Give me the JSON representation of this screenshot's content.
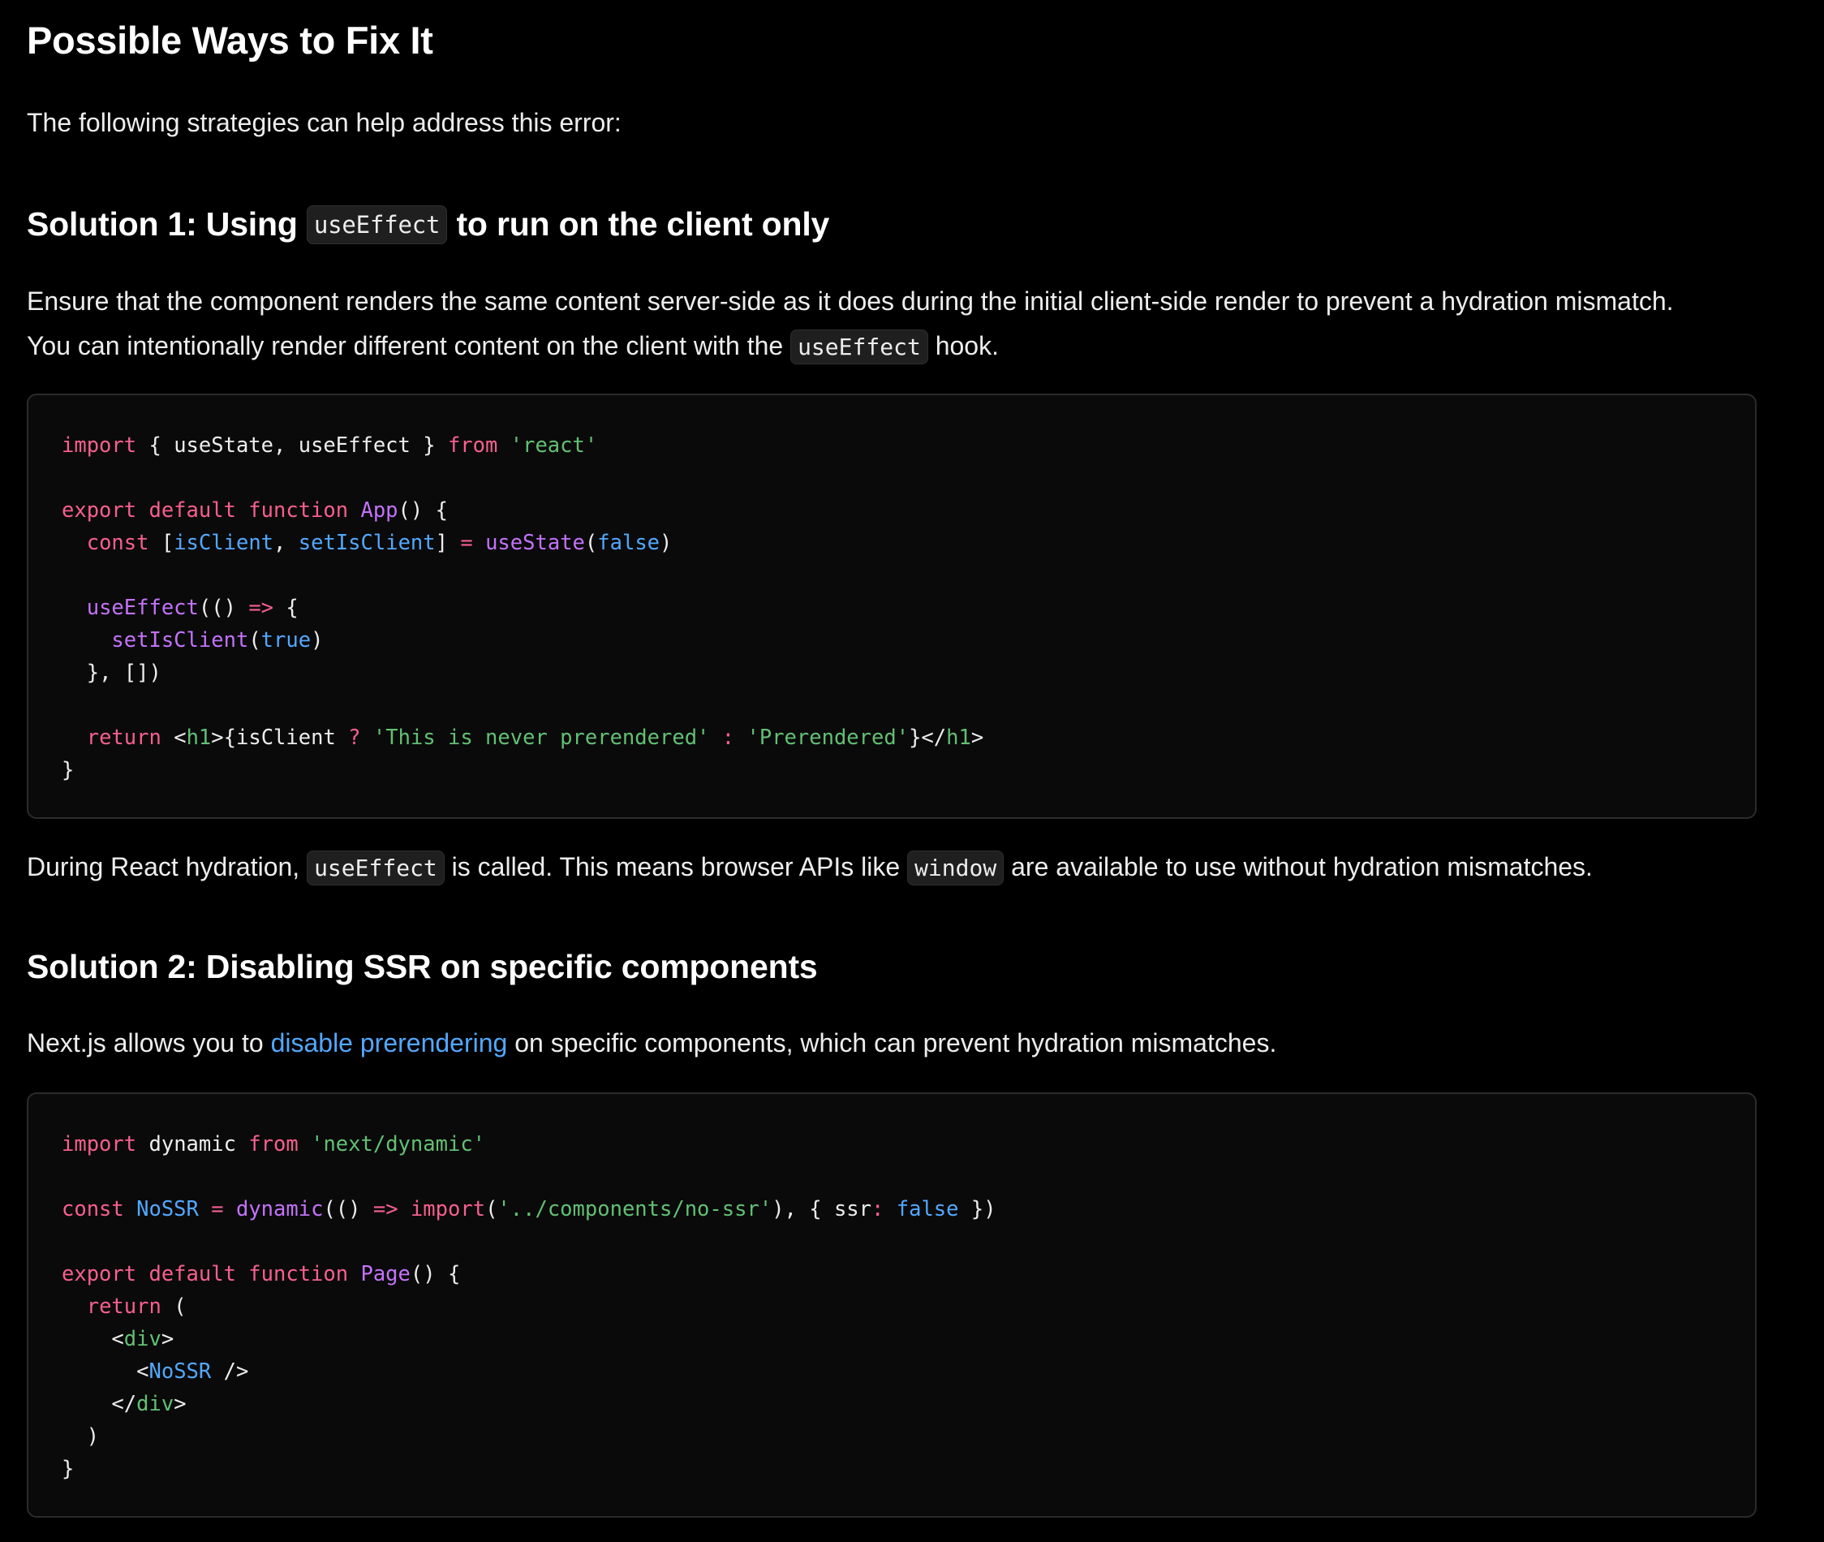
{
  "page": {
    "title": "Possible Ways to Fix It",
    "intro": "The following strategies can help address this error:"
  },
  "solution1": {
    "heading_prefix": "Solution 1: Using",
    "heading_code": "useEffect",
    "heading_suffix": "to run on the client only",
    "para_line1": "Ensure that the component renders the same content server-side as it does during the initial client-side render to prevent a hydration mismatch.",
    "para_line2_prefix": "You can intentionally render different content on the client with the",
    "para_line2_code": "useEffect",
    "para_line2_suffix": "hook.",
    "after_prefix": "During React hydration,",
    "after_code1": "useEffect",
    "after_mid": "is called. This means browser APIs like",
    "after_code2": "window",
    "after_suffix": "are available to use without hydration mismatches."
  },
  "code1": {
    "l1": [
      "import",
      "{ useState, useEffect }",
      "from",
      "'react'"
    ],
    "l3": [
      "export default function",
      "App",
      "() {"
    ],
    "l4": [
      "const",
      "[",
      "isClient",
      ",",
      "setIsClient",
      "] ",
      "=",
      "useState",
      "(",
      "false",
      ")"
    ],
    "l6": [
      "useEffect",
      "(() ",
      "=>",
      " {"
    ],
    "l7": [
      "setIsClient",
      "(",
      "true",
      ")"
    ],
    "l8": "}, [])",
    "l10": [
      "return",
      "<",
      "h1",
      ">{isClient ",
      "?",
      "'This is never prerendered'",
      ":",
      "'Prerendered'",
      "}</",
      "h1",
      ">"
    ],
    "l11": "}"
  },
  "solution2": {
    "heading": "Solution 2: Disabling SSR on specific components",
    "para_prefix": "Next.js allows you to",
    "para_link": "disable prerendering",
    "para_suffix": "on specific components, which can prevent hydration mismatches."
  },
  "code2": {
    "l1": [
      "import",
      "dynamic",
      "from",
      "'next/dynamic'"
    ],
    "l3": [
      "const",
      "NoSSR",
      "=",
      "dynamic",
      "(() ",
      "=>",
      "import",
      "(",
      "'../components/no-ssr'",
      "), { ssr",
      ":",
      "false",
      " })"
    ],
    "l5": [
      "export default function",
      "Page",
      "() {"
    ],
    "l6": [
      "return",
      " ("
    ],
    "l7": [
      "<",
      "div",
      ">"
    ],
    "l8": [
      "<",
      "NoSSR",
      " />"
    ],
    "l9": [
      "</",
      "div",
      ">"
    ],
    "l10": ")",
    "l11": "}"
  },
  "colors": {
    "background": "#000000",
    "code_bg": "#0a0a0a",
    "keyword": "#f75f8f",
    "string": "#62c073",
    "function": "#c472fb",
    "variable": "#52a8ff",
    "link": "#52a8ff"
  }
}
